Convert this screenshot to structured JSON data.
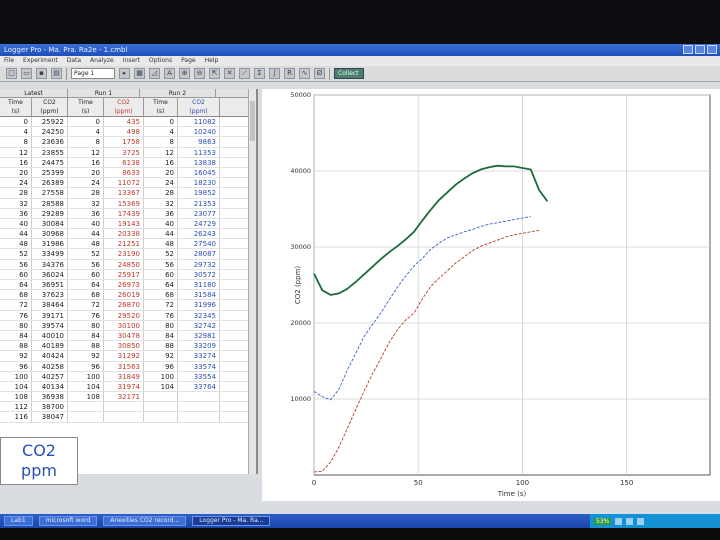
{
  "window": {
    "title": "Logger Pro - Ma. Pra. Ra2e - 1.cmbl"
  },
  "menu": [
    "File",
    "Experiment",
    "Data",
    "Analyze",
    "Insert",
    "Options",
    "Page",
    "Help"
  ],
  "toolbar": {
    "page_label": "Page 1",
    "collect_label": "Collect"
  },
  "table": {
    "groups": [
      "Latest",
      "Run 1",
      "Run 2"
    ],
    "columns": [
      {
        "name": "Time",
        "unit": "(s)"
      },
      {
        "name": "CO2",
        "unit": "(ppm)"
      },
      {
        "name": "Time",
        "unit": "(s)"
      },
      {
        "name": "CO2",
        "unit": "(ppm)"
      },
      {
        "name": "Time",
        "unit": "(s)"
      },
      {
        "name": "CO2",
        "unit": "(ppm)"
      }
    ],
    "rows": [
      [
        "0",
        "25922",
        "0",
        "435",
        "0",
        "11082"
      ],
      [
        "4",
        "24250",
        "4",
        "498",
        "4",
        "10240"
      ],
      [
        "8",
        "23636",
        "8",
        "1758",
        "8",
        "9863"
      ],
      [
        "12",
        "23855",
        "12",
        "3725",
        "12",
        "11353"
      ],
      [
        "16",
        "24475",
        "16",
        "6138",
        "16",
        "13838"
      ],
      [
        "20",
        "25399",
        "20",
        "8633",
        "20",
        "16045"
      ],
      [
        "24",
        "26389",
        "24",
        "11072",
        "24",
        "18230"
      ],
      [
        "28",
        "27558",
        "28",
        "13367",
        "28",
        "19852"
      ],
      [
        "32",
        "28588",
        "32",
        "15369",
        "32",
        "21353"
      ],
      [
        "36",
        "29289",
        "36",
        "17439",
        "36",
        "23077"
      ],
      [
        "40",
        "30084",
        "40",
        "19143",
        "40",
        "24729"
      ],
      [
        "44",
        "30968",
        "44",
        "20338",
        "44",
        "26243"
      ],
      [
        "48",
        "31986",
        "48",
        "21251",
        "48",
        "27540"
      ],
      [
        "52",
        "33499",
        "52",
        "23190",
        "52",
        "28087"
      ],
      [
        "56",
        "34376",
        "56",
        "24850",
        "56",
        "29732"
      ],
      [
        "60",
        "36024",
        "60",
        "25917",
        "60",
        "30572"
      ],
      [
        "64",
        "36951",
        "64",
        "26973",
        "64",
        "31180"
      ],
      [
        "68",
        "37623",
        "68",
        "26019",
        "68",
        "31584"
      ],
      [
        "72",
        "38464",
        "72",
        "26870",
        "72",
        "31996"
      ],
      [
        "76",
        "39171",
        "76",
        "29520",
        "76",
        "32345"
      ],
      [
        "80",
        "39574",
        "80",
        "30100",
        "80",
        "32742"
      ],
      [
        "84",
        "40010",
        "84",
        "30478",
        "84",
        "32981"
      ],
      [
        "88",
        "40189",
        "88",
        "30850",
        "88",
        "33209"
      ],
      [
        "92",
        "40424",
        "92",
        "31292",
        "92",
        "33274"
      ],
      [
        "96",
        "40258",
        "96",
        "31563",
        "96",
        "33574"
      ],
      [
        "100",
        "40257",
        "100",
        "31849",
        "100",
        "33554"
      ],
      [
        "104",
        "40134",
        "104",
        "31974",
        "104",
        "33764"
      ],
      [
        "108",
        "36938",
        "108",
        "32171",
        "",
        ""
      ],
      [
        "112",
        "38700",
        "",
        "",
        "",
        ""
      ],
      [
        "116",
        "38047",
        "",
        "",
        "",
        ""
      ]
    ]
  },
  "meter": {
    "label": "CO2",
    "unit": "ppm"
  },
  "chart_data": {
    "type": "line",
    "xlabel": "Time (s)",
    "ylabel": "CO2 (ppm)",
    "xlim": [
      0,
      190
    ],
    "ylim": [
      0,
      50000
    ],
    "x_ticks": [
      0,
      50,
      100,
      150
    ],
    "y_ticks": [
      10000,
      20000,
      30000,
      40000,
      50000
    ],
    "y_tick_labels": [
      "10000",
      "20000",
      "30000",
      "40000",
      "50000"
    ],
    "grid": true,
    "series": [
      {
        "color": "#1c6b3a",
        "x": [
          0,
          4,
          8,
          12,
          16,
          20,
          24,
          28,
          32,
          36,
          40,
          44,
          48,
          52,
          56,
          60,
          64,
          68,
          72,
          76,
          80,
          84,
          88,
          92,
          96,
          100,
          104,
          108,
          112
        ],
        "y": [
          26500,
          24300,
          23700,
          23900,
          24500,
          25400,
          26400,
          27400,
          28400,
          29300,
          30100,
          31000,
          32000,
          33500,
          34900,
          36200,
          37200,
          38200,
          39000,
          39700,
          40200,
          40500,
          40700,
          40600,
          40600,
          40400,
          40200,
          37500,
          36000
        ]
      },
      {
        "color": "#3b5fd0",
        "x": [
          0,
          4,
          8,
          12,
          16,
          20,
          24,
          28,
          32,
          36,
          40,
          44,
          48,
          52,
          56,
          60,
          64,
          68,
          72,
          76,
          80,
          84,
          88,
          92,
          96,
          100,
          104
        ],
        "y": [
          11000,
          10300,
          9900,
          11300,
          13800,
          16000,
          18200,
          19800,
          21300,
          23000,
          24700,
          26200,
          27500,
          28500,
          29700,
          30500,
          31200,
          31600,
          32000,
          32300,
          32700,
          33000,
          33200,
          33400,
          33600,
          33800,
          34000
        ]
      },
      {
        "color": "#c0392b",
        "x": [
          0,
          4,
          8,
          12,
          16,
          20,
          24,
          28,
          32,
          36,
          40,
          44,
          48,
          52,
          56,
          60,
          64,
          68,
          72,
          76,
          80,
          84,
          88,
          92,
          96,
          100,
          104,
          108
        ],
        "y": [
          400,
          500,
          1700,
          3700,
          6100,
          8600,
          11000,
          13300,
          15300,
          17400,
          19100,
          20400,
          21300,
          23200,
          24800,
          25900,
          26900,
          27900,
          28700,
          29500,
          30100,
          30500,
          30900,
          31300,
          31600,
          31800,
          32000,
          32200
        ]
      }
    ]
  },
  "taskbar": {
    "items": [
      "Lab1",
      "microsoft word",
      "Anexities CO2 record...",
      "Logger Pro - Ma. Ra..."
    ],
    "battery": "53%"
  }
}
